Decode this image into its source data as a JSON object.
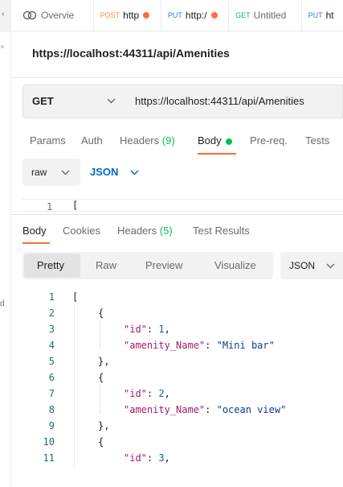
{
  "gutter": {
    "icon1": "‹",
    "icon2": "°",
    "icon3": "d"
  },
  "tabs": [
    {
      "method": "",
      "title": "Overvie",
      "icon": "overview-icon",
      "dot": false
    },
    {
      "method": "POST",
      "title": "http",
      "dot": true,
      "color": "#ff8a3d"
    },
    {
      "method": "PUT",
      "title": "http:/",
      "dot": true,
      "color": "#2b7ce9"
    },
    {
      "method": "GET",
      "title": "Untitled",
      "dot": false,
      "color": "#0cbb52"
    },
    {
      "method": "PUT",
      "title": "ht",
      "dot": false,
      "color": "#2b7ce9"
    }
  ],
  "request": {
    "title": "https://localhost:44311/api/Amenities",
    "method": "GET",
    "url": "https://localhost:44311/api/Amenities"
  },
  "request_tabs": {
    "params": "Params",
    "auth": "Auth",
    "headers": "Headers",
    "headers_count": "(9)",
    "body": "Body",
    "prereq": "Pre-req.",
    "tests": "Tests"
  },
  "body_mode": {
    "raw": "raw",
    "json": "JSON"
  },
  "editor": {
    "line": "1",
    "text": "["
  },
  "response_tabs": {
    "body": "Body",
    "cookies": "Cookies",
    "headers": "Headers",
    "headers_count": "(5)",
    "test_results": "Test Results"
  },
  "view": {
    "pretty": "Pretty",
    "raw": "Raw",
    "preview": "Preview",
    "visualize": "Visualize",
    "format": "JSON"
  },
  "response_lines": [
    {
      "n": "1",
      "indent": 0,
      "parts": [
        [
          "p",
          "["
        ]
      ]
    },
    {
      "n": "2",
      "indent": 1,
      "parts": [
        [
          "p",
          "{"
        ]
      ]
    },
    {
      "n": "3",
      "indent": 2,
      "parts": [
        [
          "k",
          "\"id\""
        ],
        [
          "p",
          ": "
        ],
        [
          "n",
          "1"
        ],
        [
          "p",
          ","
        ]
      ]
    },
    {
      "n": "4",
      "indent": 2,
      "parts": [
        [
          "k",
          "\"amenity_Name\""
        ],
        [
          "p",
          ": "
        ],
        [
          "s",
          "\"Mini bar\""
        ]
      ]
    },
    {
      "n": "5",
      "indent": 1,
      "parts": [
        [
          "p",
          "},"
        ]
      ]
    },
    {
      "n": "6",
      "indent": 1,
      "parts": [
        [
          "p",
          "{"
        ]
      ]
    },
    {
      "n": "7",
      "indent": 2,
      "parts": [
        [
          "k",
          "\"id\""
        ],
        [
          "p",
          ": "
        ],
        [
          "n",
          "2"
        ],
        [
          "p",
          ","
        ]
      ]
    },
    {
      "n": "8",
      "indent": 2,
      "parts": [
        [
          "k",
          "\"amenity_Name\""
        ],
        [
          "p",
          ": "
        ],
        [
          "s",
          "\"ocean view\""
        ]
      ]
    },
    {
      "n": "9",
      "indent": 1,
      "parts": [
        [
          "p",
          "},"
        ]
      ]
    },
    {
      "n": "10",
      "indent": 1,
      "parts": [
        [
          "p",
          "{"
        ]
      ]
    },
    {
      "n": "11",
      "indent": 2,
      "parts": [
        [
          "k",
          "\"id\""
        ],
        [
          "p",
          ": "
        ],
        [
          "n",
          "3"
        ],
        [
          "p",
          ","
        ]
      ]
    }
  ]
}
